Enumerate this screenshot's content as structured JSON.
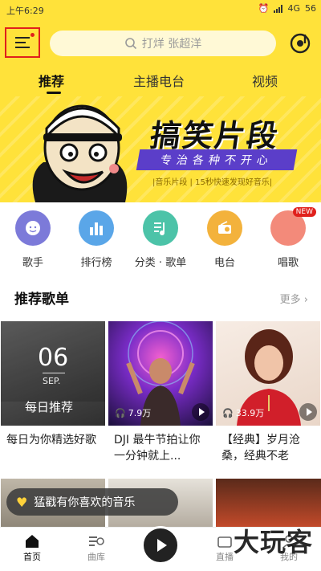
{
  "status_bar": {
    "time": "上午6:29",
    "network": "4G",
    "battery": "56"
  },
  "header": {
    "search_placeholder": "打烊 张超洋",
    "tabs": [
      {
        "label": "推荐",
        "active": true
      },
      {
        "label": "主播电台",
        "active": false
      },
      {
        "label": "视频",
        "active": false
      }
    ]
  },
  "banner": {
    "title": "搞笑片段",
    "subtitle": "专治各种不开心",
    "note": "|音乐片段 | 15秒快速发现好音乐|"
  },
  "categories": [
    {
      "label": "歌手",
      "icon": "singer-icon",
      "color": "#7c7ad9"
    },
    {
      "label": "排行榜",
      "icon": "chart-bars-icon",
      "color": "#5aa6e8"
    },
    {
      "label": "分类 · 歌单",
      "icon": "music-list-icon",
      "color": "#4cc3a8"
    },
    {
      "label": "电台",
      "icon": "radio-icon",
      "color": "#f3b23c"
    },
    {
      "label": "唱歌",
      "icon": "sing-icon",
      "color": "#f38a7a",
      "badge": "NEW"
    }
  ],
  "section": {
    "title": "推荐歌单",
    "more": "更多"
  },
  "playlists": [
    {
      "caption": "每日为你精选好歌",
      "date_day": "06",
      "date_month": "SEP.",
      "title": "每日推荐",
      "plays": ""
    },
    {
      "caption": "DJI 最牛节拍让你一分钟就上...",
      "plays": "7.9万"
    },
    {
      "caption": "【经典】岁月沧桑，经典不老",
      "plays": "33.9万"
    }
  ],
  "toast": {
    "text": "猛戳有你喜欢的音乐"
  },
  "bottom_nav": [
    {
      "label": "首页",
      "icon": "home-icon",
      "active": true
    },
    {
      "label": "曲库",
      "icon": "library-icon",
      "active": false
    },
    {
      "label": "直播",
      "icon": "live-icon",
      "active": false
    },
    {
      "label": "我的",
      "icon": "profile-icon",
      "active": false
    }
  ],
  "watermark": "大玩客",
  "colors": {
    "brand_yellow": "#ffe23a",
    "accent_red": "#e0201c",
    "purple": "#5b3ec9"
  }
}
